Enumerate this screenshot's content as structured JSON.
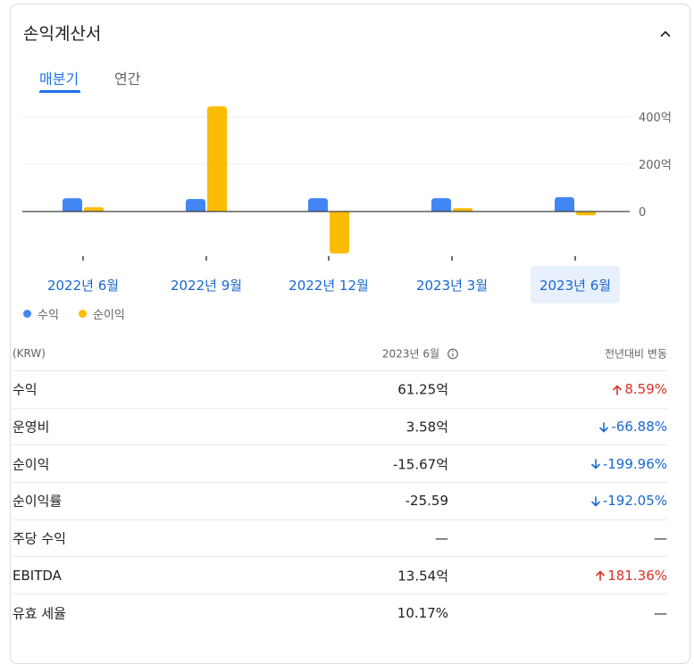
{
  "card": {
    "title": "손익계산서",
    "tabs": [
      {
        "label": "매분기",
        "active": true
      },
      {
        "label": "연간",
        "active": false
      }
    ]
  },
  "chart_data": {
    "type": "bar",
    "categories": [
      "2022년 6월",
      "2022년 9월",
      "2022년 12월",
      "2023년 3월",
      "2023년 6월"
    ],
    "selected_category": "2023년 6월",
    "series": [
      {
        "name": "수익",
        "color": "#4285f4",
        "values": [
          56,
          53,
          56,
          56,
          61
        ]
      },
      {
        "name": "순이익",
        "color": "#fbbc04",
        "values": [
          18,
          445,
          -178,
          14,
          -16
        ]
      }
    ],
    "y_ticks": [
      {
        "value": 400,
        "label": "400억"
      },
      {
        "value": 200,
        "label": "200억"
      },
      {
        "value": 0,
        "label": "0"
      }
    ],
    "ylim": [
      -200,
      450
    ],
    "unit": "억"
  },
  "legend": [
    {
      "label": "수익",
      "color": "#4285f4"
    },
    {
      "label": "순이익",
      "color": "#fbbc04"
    }
  ],
  "table": {
    "header": {
      "col1": "(KRW)",
      "col2": "2023년 6월",
      "col3": "전년대비 변동"
    },
    "rows": [
      {
        "label": "수익",
        "value": "61.25억",
        "change": "8.59%",
        "dir": "up"
      },
      {
        "label": "운영비",
        "value": "3.58억",
        "change": "-66.88%",
        "dir": "down"
      },
      {
        "label": "순이익",
        "value": "-15.67억",
        "change": "-199.96%",
        "dir": "down"
      },
      {
        "label": "순이익률",
        "value": "-25.59",
        "change": "-192.05%",
        "dir": "down"
      },
      {
        "label": "주당 수익",
        "value": "—",
        "change": "—",
        "dir": "none"
      },
      {
        "label": "EBITDA",
        "value": "13.54억",
        "change": "181.36%",
        "dir": "up"
      },
      {
        "label": "유효 세율",
        "value": "10.17%",
        "change": "—",
        "dir": "none"
      }
    ]
  }
}
